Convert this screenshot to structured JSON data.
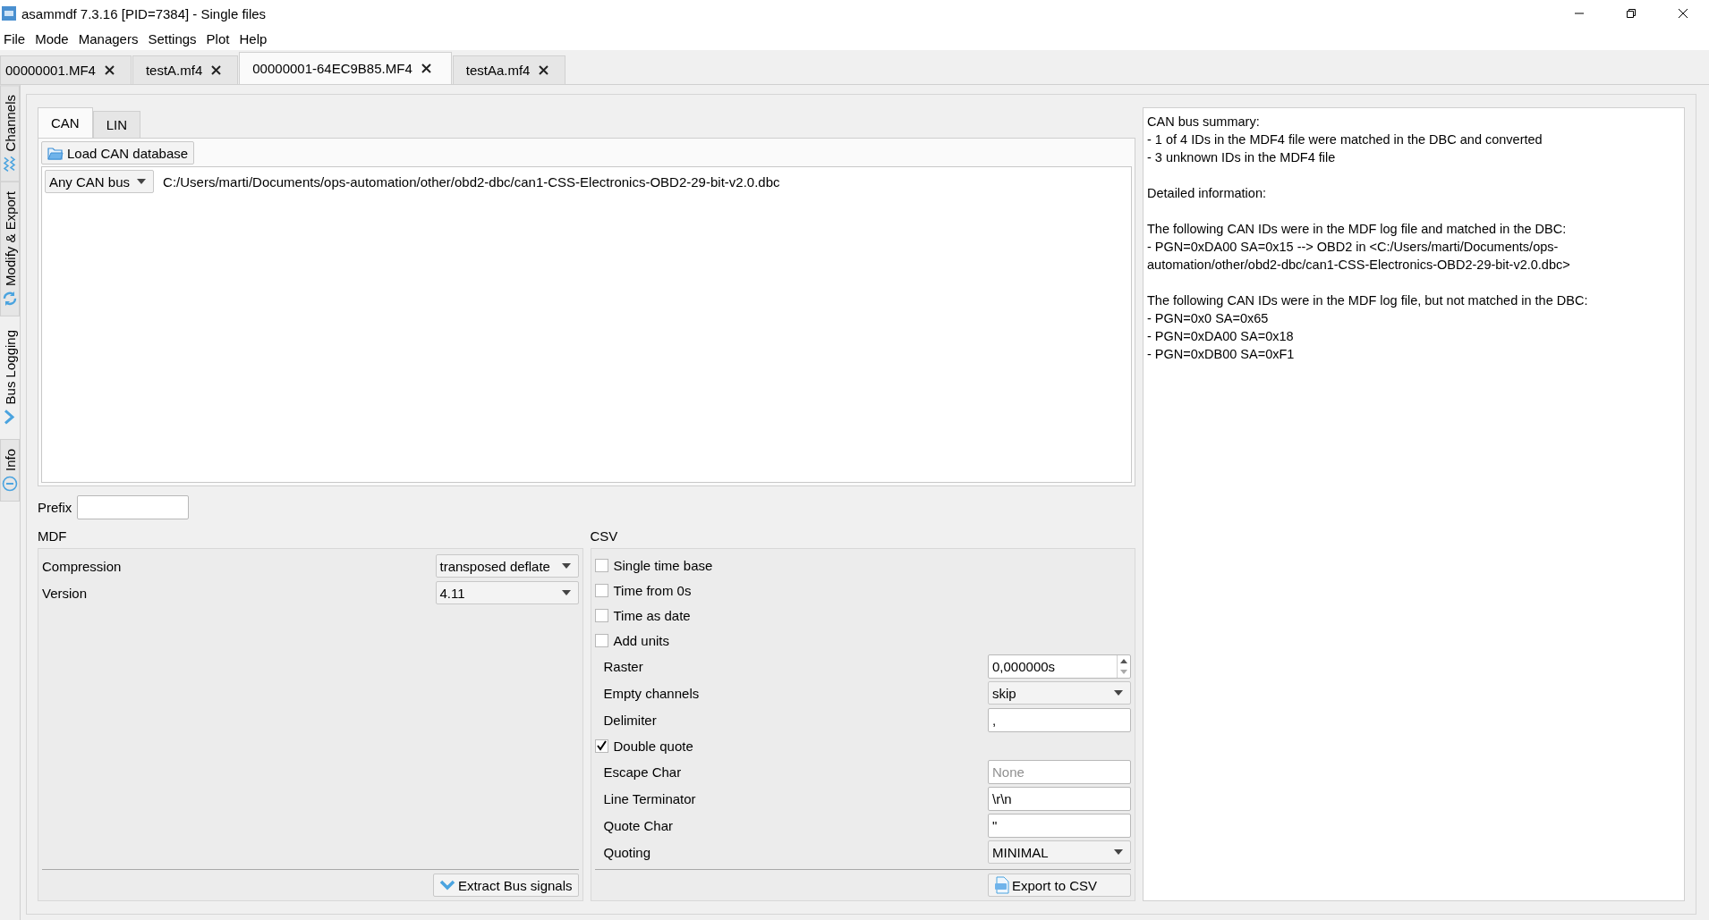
{
  "window": {
    "title": "asammdf 7.3.16 [PID=7384] - Single files"
  },
  "menu": [
    "File",
    "Mode",
    "Managers",
    "Settings",
    "Plot",
    "Help"
  ],
  "file_tabs": [
    {
      "label": "00000001.MF4",
      "selected": false
    },
    {
      "label": "testA.mf4",
      "selected": false
    },
    {
      "label": "00000001-64EC9B85.MF4",
      "selected": true
    },
    {
      "label": "testAa.mf4",
      "selected": false
    }
  ],
  "side_tabs": [
    {
      "label": "Channels",
      "selected": false
    },
    {
      "label": "Modify & Export",
      "selected": false
    },
    {
      "label": "Bus Logging",
      "selected": true
    },
    {
      "label": "Info",
      "selected": false
    }
  ],
  "bus_tabs": [
    {
      "label": "CAN",
      "selected": true
    },
    {
      "label": "LIN",
      "selected": false
    }
  ],
  "load_button": "Load CAN database",
  "databases": [
    {
      "bus": "Any CAN bus",
      "path": "C:/Users/marti/Documents/ops-automation/other/obd2-dbc/can1-CSS-Electronics-OBD2-29-bit-v2.0.dbc"
    }
  ],
  "prefix": {
    "label": "Prefix"
  },
  "mdf": {
    "title": "MDF",
    "rows": [
      {
        "kind": "dropdown",
        "label": "Compression",
        "value": "transposed deflate"
      },
      {
        "kind": "dropdown",
        "label": "Version",
        "value": "4.11"
      }
    ],
    "button": "Extract Bus signals"
  },
  "csv": {
    "title": "CSV",
    "rows": [
      {
        "kind": "checkbox",
        "label": "Single time base",
        "checked": false
      },
      {
        "kind": "checkbox",
        "label": "Time from 0s",
        "checked": false
      },
      {
        "kind": "checkbox",
        "label": "Time as date",
        "checked": false
      },
      {
        "kind": "checkbox",
        "label": "Add units",
        "checked": false
      },
      {
        "kind": "spinbox",
        "label": "Raster",
        "value": "0,000000s"
      },
      {
        "kind": "dropdown",
        "label": "Empty channels",
        "value": "skip"
      },
      {
        "kind": "text",
        "label": "Delimiter",
        "value": ","
      },
      {
        "kind": "checkbox",
        "label": "Double quote",
        "checked": true
      },
      {
        "kind": "text",
        "label": "Escape Char",
        "placeholder": "None"
      },
      {
        "kind": "text",
        "label": "Line Terminator",
        "value": "\\r\\n"
      },
      {
        "kind": "text",
        "label": "Quote Char",
        "value": "\""
      },
      {
        "kind": "dropdown",
        "label": "Quoting",
        "value": "MINIMAL"
      }
    ],
    "button": "Export to CSV"
  },
  "summary": {
    "paragraphs": [
      [
        "CAN bus summary:",
        "- 1 of 4 IDs in the MDF4 file were matched in the DBC and converted",
        "- 3 unknown IDs in the MDF4 file"
      ],
      [
        "Detailed information:"
      ],
      [
        "The following CAN IDs were in the MDF log file and matched in the DBC:",
        "- PGN=0xDA00 SA=0x15 --> OBD2 in <C:/Users/marti/Documents/ops-automation/other/obd2-dbc/can1-CSS-Electronics-OBD2-29-bit-v2.0.dbc>"
      ],
      [
        "The following CAN IDs were in the MDF log file, but not matched in the DBC:",
        "- PGN=0x0 SA=0x65",
        "- PGN=0xDA00 SA=0x18",
        "- PGN=0xDB00 SA=0xF1"
      ]
    ]
  }
}
